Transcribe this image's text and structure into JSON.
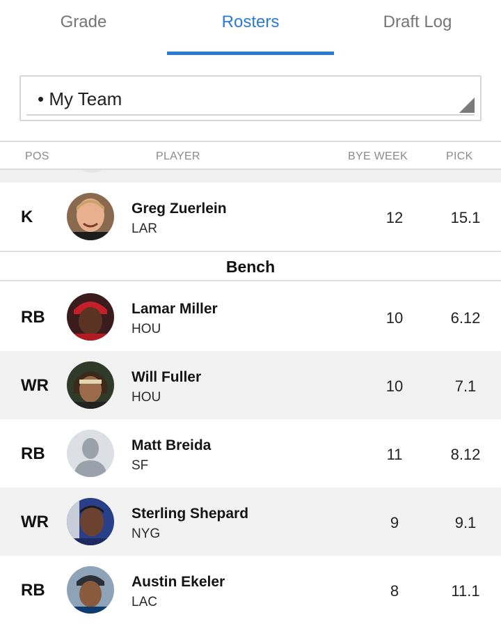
{
  "tabs": [
    {
      "label": "Grade",
      "active": false
    },
    {
      "label": "Rosters",
      "active": true
    },
    {
      "label": "Draft Log",
      "active": false
    }
  ],
  "accent_color": "#2b7bd6",
  "team_selector": {
    "value": "• My Team"
  },
  "columns": {
    "pos": "POS",
    "player": "PLAYER",
    "bye": "BYE WEEK",
    "pick": "PICK"
  },
  "starter_rows": [
    {
      "pos": "K",
      "name": "Greg Zuerlein",
      "team": "LAR",
      "bye": "12",
      "pick": "15.1",
      "avatar": "player-photo"
    }
  ],
  "bench_section": {
    "label": "Bench"
  },
  "bench_rows": [
    {
      "pos": "RB",
      "name": "Lamar Miller",
      "team": "HOU",
      "bye": "10",
      "pick": "6.12",
      "avatar": "player-photo"
    },
    {
      "pos": "WR",
      "name": "Will Fuller",
      "team": "HOU",
      "bye": "10",
      "pick": "7.1",
      "avatar": "player-photo"
    },
    {
      "pos": "RB",
      "name": "Matt Breida",
      "team": "SF",
      "bye": "11",
      "pick": "8.12",
      "avatar": "placeholder-silhouette"
    },
    {
      "pos": "WR",
      "name": "Sterling Shepard",
      "team": "NYG",
      "bye": "9",
      "pick": "9.1",
      "avatar": "player-photo"
    },
    {
      "pos": "RB",
      "name": "Austin Ekeler",
      "team": "LAC",
      "bye": "8",
      "pick": "11.1",
      "avatar": "player-photo"
    }
  ]
}
